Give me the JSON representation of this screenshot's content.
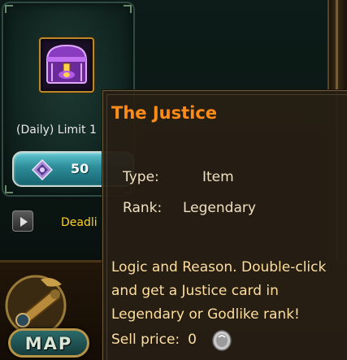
{
  "shop_item": {
    "limit_label": "(Daily) Limit 1",
    "price": "50",
    "icon": "treasure-chest-icon",
    "currency_icon": "gem-icon"
  },
  "footer": {
    "deadline_label": "Deadli",
    "play_icon": "play-icon"
  },
  "map_button": {
    "label": "MAP",
    "icon": "spyglass-icon"
  },
  "tooltip": {
    "title": "The Justice",
    "type_label": "Type:",
    "type_value": "Item",
    "rank_label": "Rank:",
    "rank_value": "Legendary",
    "description": "Logic and Reason. Double-click and get a Justice card in Legendary or Godlike rank!",
    "sell_label": "Sell price:",
    "sell_value": "0",
    "sell_icon": "silver-coin-icon"
  },
  "colors": {
    "title": "#ff8c18",
    "description": "#ffdf9e",
    "deadline": "#ffd21e",
    "price_bar": "#2c8c98"
  }
}
